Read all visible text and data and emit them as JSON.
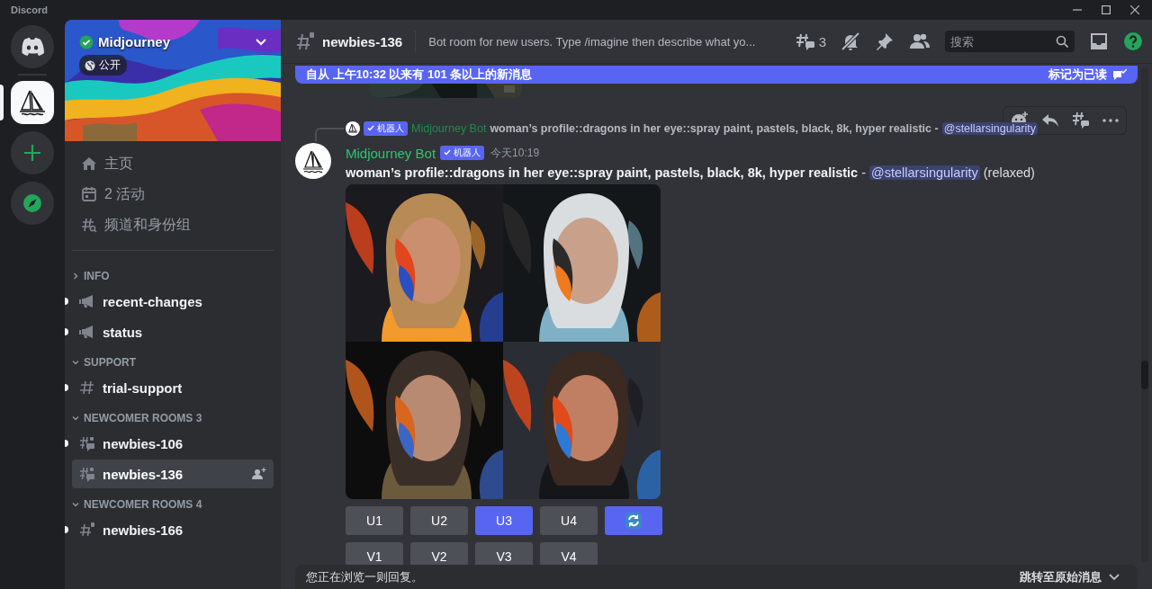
{
  "window": {
    "title": "Discord"
  },
  "servers": [
    {
      "kind": "home",
      "selected": false
    },
    {
      "kind": "guild",
      "selected": true
    },
    {
      "kind": "add",
      "selected": false
    },
    {
      "kind": "discover",
      "selected": false
    }
  ],
  "server": {
    "name": "Midjourney",
    "verified": true,
    "badge": "公开"
  },
  "nav": [
    {
      "kind": "home",
      "label": "主页"
    },
    {
      "kind": "events",
      "label": "2 活动"
    },
    {
      "kind": "browse",
      "label": "频道和身份组"
    }
  ],
  "categories": [
    {
      "name": "INFO",
      "expanded": false,
      "channels": [
        {
          "kind": "announcement",
          "name": "recent-changes",
          "unread": true,
          "selected": false
        },
        {
          "kind": "announcement",
          "name": "status",
          "unread": true,
          "selected": false
        }
      ]
    },
    {
      "name": "SUPPORT",
      "expanded": true,
      "channels": [
        {
          "kind": "text",
          "name": "trial-support",
          "unread": true,
          "selected": false
        }
      ]
    },
    {
      "name": "NEWCOMER ROOMS 3",
      "expanded": true,
      "channels": [
        {
          "kind": "locked-thread",
          "name": "newbies-106",
          "unread": true,
          "selected": false
        },
        {
          "kind": "locked-thread",
          "name": "newbies-136",
          "unread": false,
          "selected": true
        }
      ]
    },
    {
      "name": "NEWCOMER ROOMS 4",
      "expanded": true,
      "channels": [
        {
          "kind": "locked",
          "name": "newbies-166",
          "unread": true,
          "selected": false
        }
      ]
    }
  ],
  "header": {
    "channel": "newbies-136",
    "topic": "Bot room for new users. Type /imagine then describe what yo...",
    "threads": "3",
    "search": {
      "placeholder": "搜索"
    }
  },
  "banner": {
    "text": "自从 上午10:32 以来有 101 条以上的新消息",
    "action": "标记为已读"
  },
  "previous": {
    "kind": "picture"
  },
  "message": {
    "reply": {
      "badge": "机器人",
      "author": "Midjourney Bot",
      "text": "woman’s profile::dragons in her eye::spray paint, pastels, black, 8k, hyper realistic -",
      "mention": "@stellarsingularity"
    },
    "author": "Midjourney Bot",
    "badge": "机器人",
    "time": "今天10:19",
    "text": "woman’s profile::dragons in her eye::spray paint, pastels, black, 8k, hyper realistic",
    "separator": "-",
    "mention": "@stellarsingularity",
    "suffix": "(relaxed)",
    "images": [
      {
        "kind": "picture"
      },
      {
        "kind": "picture"
      },
      {
        "kind": "picture"
      },
      {
        "kind": "picture"
      }
    ],
    "button_rows": [
      [
        {
          "kind": "label",
          "label": "U1",
          "selected": false
        },
        {
          "kind": "label",
          "label": "U2",
          "selected": false
        },
        {
          "kind": "label",
          "label": "U3",
          "selected": true
        },
        {
          "kind": "label",
          "label": "U4",
          "selected": false
        },
        {
          "kind": "refresh",
          "selected": true
        }
      ],
      [
        {
          "kind": "label",
          "label": "V1",
          "selected": false
        },
        {
          "kind": "label",
          "label": "V2",
          "selected": false
        },
        {
          "kind": "label",
          "label": "V3",
          "selected": false
        },
        {
          "kind": "label",
          "label": "V4",
          "selected": false
        }
      ]
    ]
  },
  "footer": {
    "text": "您正在浏览一则回复。",
    "action": "跳转至原始消息"
  }
}
